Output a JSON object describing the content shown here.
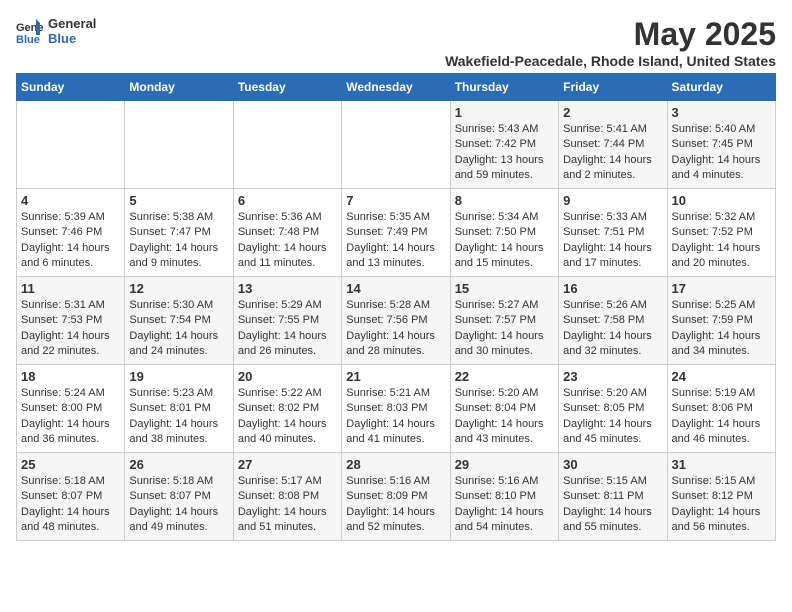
{
  "header": {
    "logo_line1": "General",
    "logo_line2": "Blue",
    "month_year": "May 2025",
    "location": "Wakefield-Peacedale, Rhode Island, United States"
  },
  "days_of_week": [
    "Sunday",
    "Monday",
    "Tuesday",
    "Wednesday",
    "Thursday",
    "Friday",
    "Saturday"
  ],
  "weeks": [
    [
      {
        "day": "",
        "info": ""
      },
      {
        "day": "",
        "info": ""
      },
      {
        "day": "",
        "info": ""
      },
      {
        "day": "",
        "info": ""
      },
      {
        "day": "1",
        "info": "Sunrise: 5:43 AM\nSunset: 7:42 PM\nDaylight: 13 hours and 59 minutes."
      },
      {
        "day": "2",
        "info": "Sunrise: 5:41 AM\nSunset: 7:44 PM\nDaylight: 14 hours and 2 minutes."
      },
      {
        "day": "3",
        "info": "Sunrise: 5:40 AM\nSunset: 7:45 PM\nDaylight: 14 hours and 4 minutes."
      }
    ],
    [
      {
        "day": "4",
        "info": "Sunrise: 5:39 AM\nSunset: 7:46 PM\nDaylight: 14 hours and 6 minutes."
      },
      {
        "day": "5",
        "info": "Sunrise: 5:38 AM\nSunset: 7:47 PM\nDaylight: 14 hours and 9 minutes."
      },
      {
        "day": "6",
        "info": "Sunrise: 5:36 AM\nSunset: 7:48 PM\nDaylight: 14 hours and 11 minutes."
      },
      {
        "day": "7",
        "info": "Sunrise: 5:35 AM\nSunset: 7:49 PM\nDaylight: 14 hours and 13 minutes."
      },
      {
        "day": "8",
        "info": "Sunrise: 5:34 AM\nSunset: 7:50 PM\nDaylight: 14 hours and 15 minutes."
      },
      {
        "day": "9",
        "info": "Sunrise: 5:33 AM\nSunset: 7:51 PM\nDaylight: 14 hours and 17 minutes."
      },
      {
        "day": "10",
        "info": "Sunrise: 5:32 AM\nSunset: 7:52 PM\nDaylight: 14 hours and 20 minutes."
      }
    ],
    [
      {
        "day": "11",
        "info": "Sunrise: 5:31 AM\nSunset: 7:53 PM\nDaylight: 14 hours and 22 minutes."
      },
      {
        "day": "12",
        "info": "Sunrise: 5:30 AM\nSunset: 7:54 PM\nDaylight: 14 hours and 24 minutes."
      },
      {
        "day": "13",
        "info": "Sunrise: 5:29 AM\nSunset: 7:55 PM\nDaylight: 14 hours and 26 minutes."
      },
      {
        "day": "14",
        "info": "Sunrise: 5:28 AM\nSunset: 7:56 PM\nDaylight: 14 hours and 28 minutes."
      },
      {
        "day": "15",
        "info": "Sunrise: 5:27 AM\nSunset: 7:57 PM\nDaylight: 14 hours and 30 minutes."
      },
      {
        "day": "16",
        "info": "Sunrise: 5:26 AM\nSunset: 7:58 PM\nDaylight: 14 hours and 32 minutes."
      },
      {
        "day": "17",
        "info": "Sunrise: 5:25 AM\nSunset: 7:59 PM\nDaylight: 14 hours and 34 minutes."
      }
    ],
    [
      {
        "day": "18",
        "info": "Sunrise: 5:24 AM\nSunset: 8:00 PM\nDaylight: 14 hours and 36 minutes."
      },
      {
        "day": "19",
        "info": "Sunrise: 5:23 AM\nSunset: 8:01 PM\nDaylight: 14 hours and 38 minutes."
      },
      {
        "day": "20",
        "info": "Sunrise: 5:22 AM\nSunset: 8:02 PM\nDaylight: 14 hours and 40 minutes."
      },
      {
        "day": "21",
        "info": "Sunrise: 5:21 AM\nSunset: 8:03 PM\nDaylight: 14 hours and 41 minutes."
      },
      {
        "day": "22",
        "info": "Sunrise: 5:20 AM\nSunset: 8:04 PM\nDaylight: 14 hours and 43 minutes."
      },
      {
        "day": "23",
        "info": "Sunrise: 5:20 AM\nSunset: 8:05 PM\nDaylight: 14 hours and 45 minutes."
      },
      {
        "day": "24",
        "info": "Sunrise: 5:19 AM\nSunset: 8:06 PM\nDaylight: 14 hours and 46 minutes."
      }
    ],
    [
      {
        "day": "25",
        "info": "Sunrise: 5:18 AM\nSunset: 8:07 PM\nDaylight: 14 hours and 48 minutes."
      },
      {
        "day": "26",
        "info": "Sunrise: 5:18 AM\nSunset: 8:07 PM\nDaylight: 14 hours and 49 minutes."
      },
      {
        "day": "27",
        "info": "Sunrise: 5:17 AM\nSunset: 8:08 PM\nDaylight: 14 hours and 51 minutes."
      },
      {
        "day": "28",
        "info": "Sunrise: 5:16 AM\nSunset: 8:09 PM\nDaylight: 14 hours and 52 minutes."
      },
      {
        "day": "29",
        "info": "Sunrise: 5:16 AM\nSunset: 8:10 PM\nDaylight: 14 hours and 54 minutes."
      },
      {
        "day": "30",
        "info": "Sunrise: 5:15 AM\nSunset: 8:11 PM\nDaylight: 14 hours and 55 minutes."
      },
      {
        "day": "31",
        "info": "Sunrise: 5:15 AM\nSunset: 8:12 PM\nDaylight: 14 hours and 56 minutes."
      }
    ]
  ]
}
